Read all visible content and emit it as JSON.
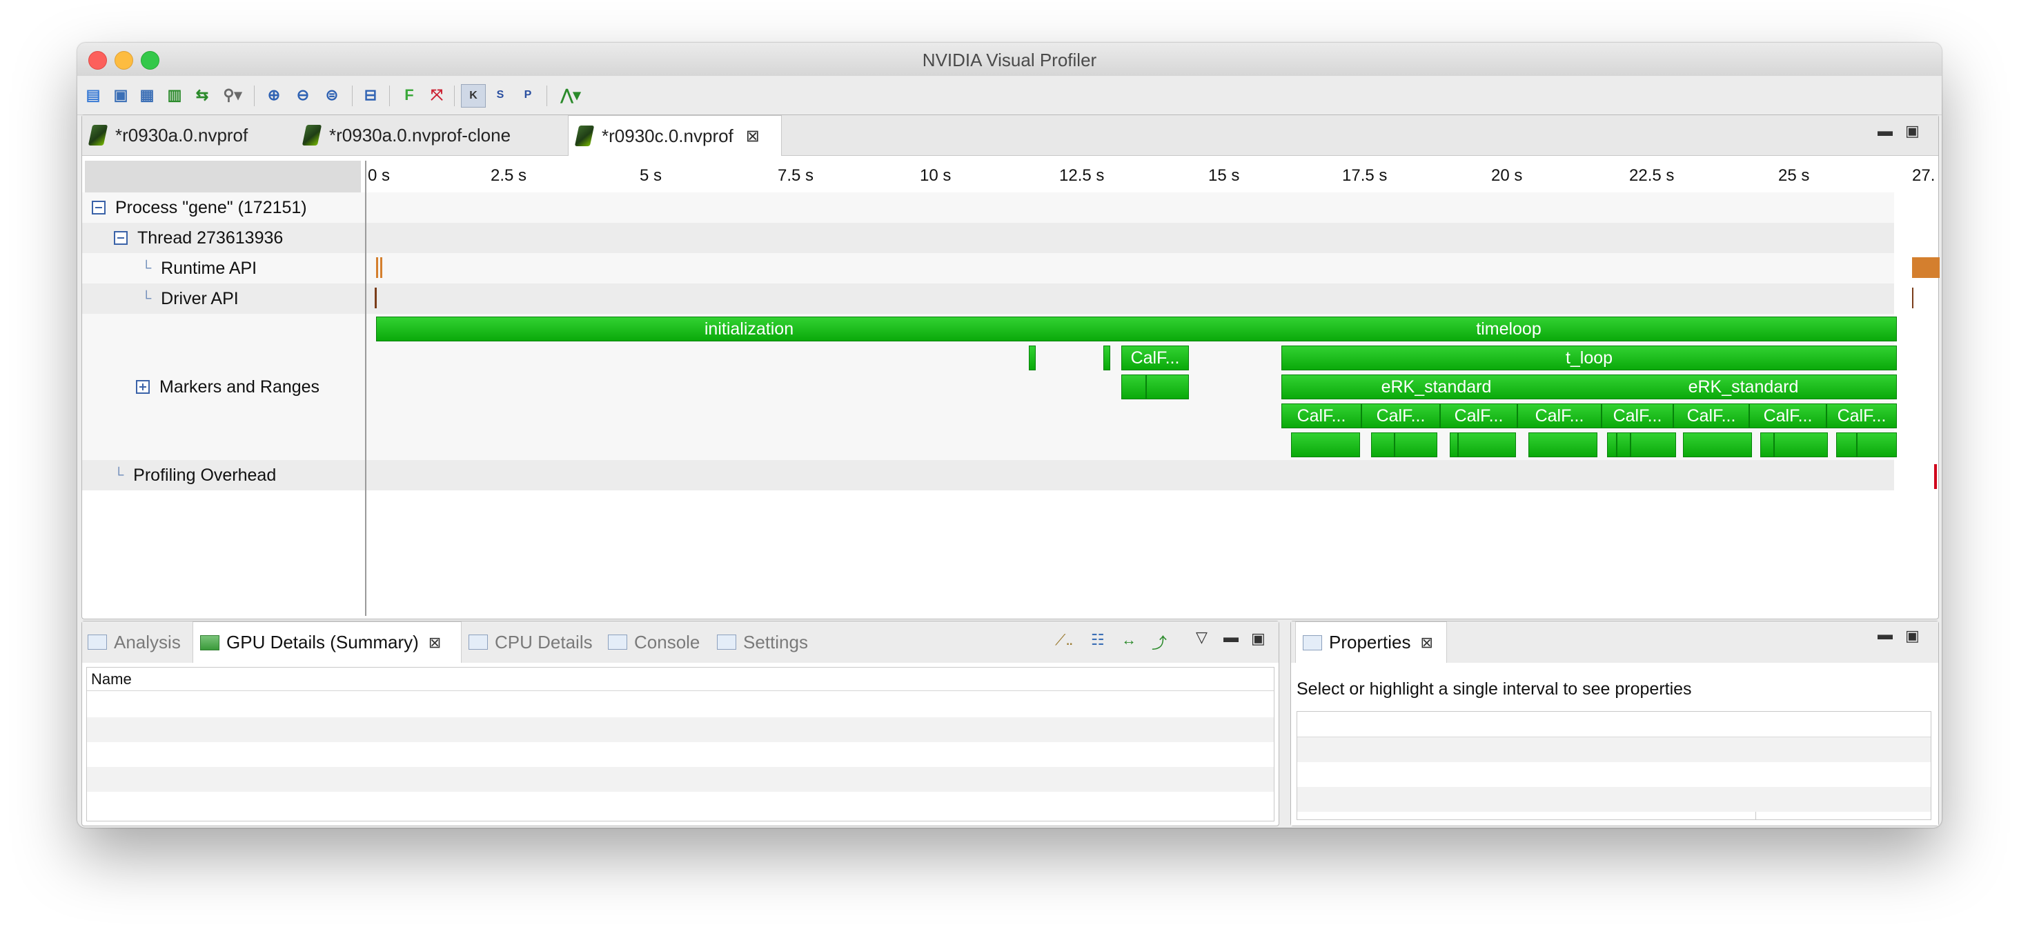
{
  "window": {
    "title": "NVIDIA Visual Profiler"
  },
  "toolbar": {
    "icons": [
      "new-session-icon",
      "save-icon",
      "save-all-icon",
      "import-icon",
      "export-icon",
      "search-options-icon",
      "zoom-in-icon",
      "zoom-out-icon",
      "zoom-fit-icon",
      "collapse-icon",
      "filter-icon",
      "clear-filter-icon",
      "kernel-icon",
      "stream-icon",
      "process-icon",
      "analysis-tree-icon"
    ],
    "k_label": "K",
    "s_label": "S",
    "p_label": "P"
  },
  "editor_tabs": [
    {
      "label": "*r0930a.0.nvprof"
    },
    {
      "label": "*r0930a.0.nvprof-clone"
    },
    {
      "label": "*r0930c.0.nvprof"
    }
  ],
  "tree": {
    "process": "Process \"gene\" (172151)",
    "thread": "Thread 273613936",
    "runtime_api": "Runtime API",
    "driver_api": "Driver API",
    "markers": "Markers and Ranges",
    "overhead": "Profiling Overhead"
  },
  "ruler": {
    "ticks": [
      "0 s",
      "2.5 s",
      "5 s",
      "7.5 s",
      "10 s",
      "12.5 s",
      "15 s",
      "17.5 s",
      "20 s",
      "22.5 s",
      "25 s",
      "27."
    ]
  },
  "ranges": {
    "initialization": "initialization",
    "timeloop": "timeloop",
    "calf_first": "CalF...",
    "t_loop": "t_loop",
    "erk1": "eRK_standard",
    "erk2": "eRK_standard",
    "calf": [
      "CalF...",
      "CalF...",
      "CalF...",
      "CalF...",
      "CalF...",
      "CalF...",
      "CalF...",
      "CalF..."
    ]
  },
  "colors": {
    "range_green": "#1bbf1b",
    "runtime_orange": "#d47f2e",
    "overhead_red": "#d0021b"
  },
  "bottom_left": {
    "tabs": [
      "Analysis",
      "GPU Details (Summary)",
      "CPU Details",
      "Console",
      "Settings"
    ],
    "active": "GPU Details (Summary)",
    "column": "Name"
  },
  "bottom_right": {
    "tab": "Properties",
    "message": "Select or highlight a single interval to see properties"
  }
}
